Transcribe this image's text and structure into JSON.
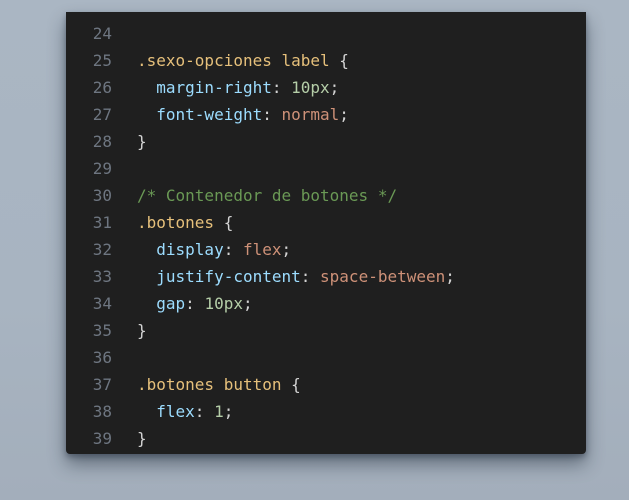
{
  "colors": {
    "background": "#a8b4c1",
    "editor_bg": "#1f1f1f",
    "line_number": "#6e7681",
    "selector": "#e6c07b",
    "property": "#9cdcfe",
    "number": "#b5cea8",
    "keyword_value": "#ce9178",
    "comment": "#6a9955",
    "punctuation": "#d4d4d4"
  },
  "editor": {
    "lines": [
      {
        "number": "24",
        "tokens": []
      },
      {
        "number": "25",
        "tokens": [
          {
            "type": "selector",
            "text": ".sexo-opciones label"
          },
          {
            "type": "punct",
            "text": " {"
          }
        ]
      },
      {
        "number": "26",
        "tokens": [
          {
            "type": "indent",
            "text": "  "
          },
          {
            "type": "prop",
            "text": "margin-right"
          },
          {
            "type": "colon",
            "text": ": "
          },
          {
            "type": "num",
            "text": "10px"
          },
          {
            "type": "punct",
            "text": ";"
          }
        ]
      },
      {
        "number": "27",
        "tokens": [
          {
            "type": "indent",
            "text": "  "
          },
          {
            "type": "prop",
            "text": "font-weight"
          },
          {
            "type": "colon",
            "text": ": "
          },
          {
            "type": "kw",
            "text": "normal"
          },
          {
            "type": "punct",
            "text": ";"
          }
        ]
      },
      {
        "number": "28",
        "tokens": [
          {
            "type": "punct",
            "text": "}"
          }
        ]
      },
      {
        "number": "29",
        "tokens": []
      },
      {
        "number": "30",
        "tokens": [
          {
            "type": "comment",
            "text": "/* Contenedor de botones */"
          }
        ]
      },
      {
        "number": "31",
        "tokens": [
          {
            "type": "selector",
            "text": ".botones"
          },
          {
            "type": "punct",
            "text": " {"
          }
        ]
      },
      {
        "number": "32",
        "tokens": [
          {
            "type": "indent",
            "text": "  "
          },
          {
            "type": "prop",
            "text": "display"
          },
          {
            "type": "colon",
            "text": ": "
          },
          {
            "type": "kw",
            "text": "flex"
          },
          {
            "type": "punct",
            "text": ";"
          }
        ]
      },
      {
        "number": "33",
        "tokens": [
          {
            "type": "indent",
            "text": "  "
          },
          {
            "type": "prop",
            "text": "justify-content"
          },
          {
            "type": "colon",
            "text": ": "
          },
          {
            "type": "kw",
            "text": "space-between"
          },
          {
            "type": "punct",
            "text": ";"
          }
        ]
      },
      {
        "number": "34",
        "tokens": [
          {
            "type": "indent",
            "text": "  "
          },
          {
            "type": "prop",
            "text": "gap"
          },
          {
            "type": "colon",
            "text": ": "
          },
          {
            "type": "num",
            "text": "10px"
          },
          {
            "type": "punct",
            "text": ";"
          }
        ]
      },
      {
        "number": "35",
        "tokens": [
          {
            "type": "punct",
            "text": "}"
          }
        ]
      },
      {
        "number": "36",
        "tokens": []
      },
      {
        "number": "37",
        "tokens": [
          {
            "type": "selector",
            "text": ".botones button"
          },
          {
            "type": "punct",
            "text": " {"
          }
        ]
      },
      {
        "number": "38",
        "tokens": [
          {
            "type": "indent",
            "text": "  "
          },
          {
            "type": "prop",
            "text": "flex"
          },
          {
            "type": "colon",
            "text": ": "
          },
          {
            "type": "num",
            "text": "1"
          },
          {
            "type": "punct",
            "text": ";"
          }
        ]
      },
      {
        "number": "39",
        "tokens": [
          {
            "type": "punct",
            "text": "}"
          }
        ]
      }
    ]
  }
}
